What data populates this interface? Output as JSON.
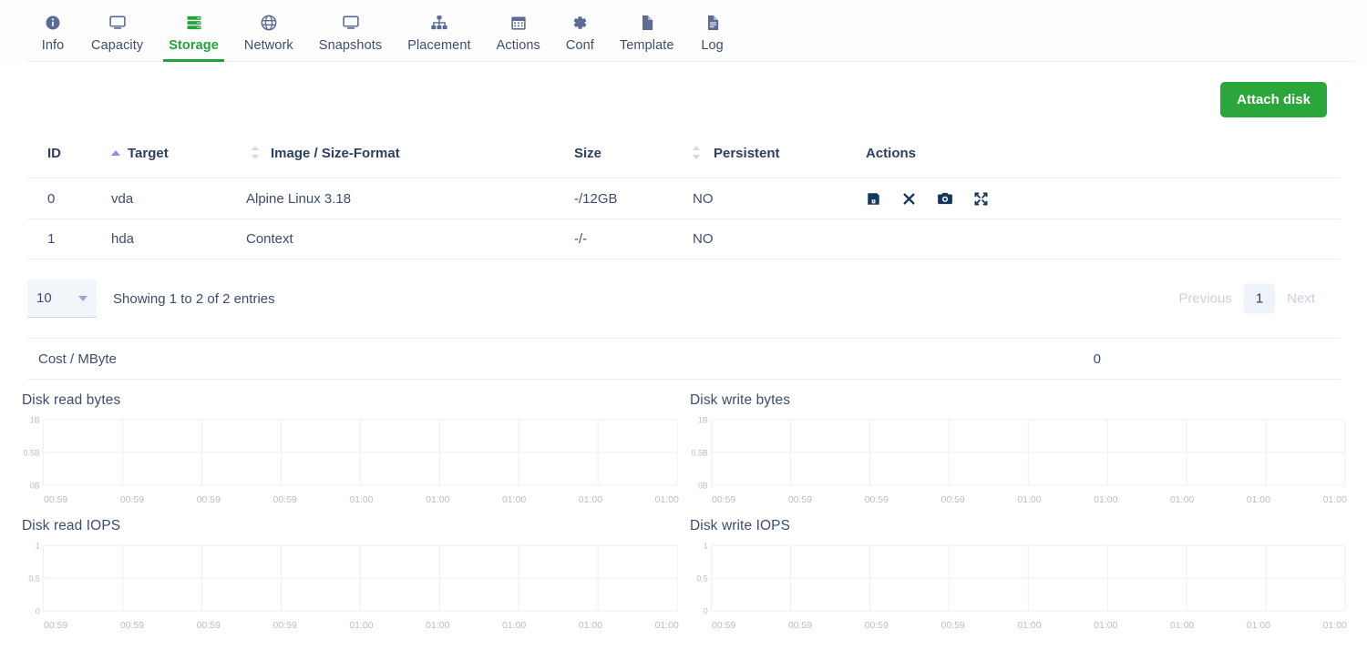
{
  "tabs": [
    {
      "label": "Info",
      "icon": "info-circle-icon",
      "active": false
    },
    {
      "label": "Capacity",
      "icon": "monitor-icon",
      "active": false
    },
    {
      "label": "Storage",
      "icon": "server-stack-icon",
      "active": true
    },
    {
      "label": "Network",
      "icon": "globe-icon",
      "active": false
    },
    {
      "label": "Snapshots",
      "icon": "monitor-icon",
      "active": false
    },
    {
      "label": "Placement",
      "icon": "sitemap-icon",
      "active": false
    },
    {
      "label": "Actions",
      "icon": "calendar-icon",
      "active": false
    },
    {
      "label": "Conf",
      "icon": "gear-icon",
      "active": false
    },
    {
      "label": "Template",
      "icon": "file-icon",
      "active": false
    },
    {
      "label": "Log",
      "icon": "file-lines-icon",
      "active": false
    }
  ],
  "toolbar": {
    "attach_disk_label": "Attach disk",
    "accent_green": "#2ba63b"
  },
  "table": {
    "headers": {
      "id": "ID",
      "target": "Target",
      "image": "Image / Size-Format",
      "size": "Size",
      "persistent": "Persistent",
      "actions": "Actions"
    },
    "sort": {
      "column": "Target",
      "direction": "asc",
      "active_color": "#8e8ee8"
    },
    "rows": [
      {
        "id": "0",
        "target": "vda",
        "image": "Alpine Linux 3.18",
        "size": "-/12GB",
        "persistent": "NO",
        "actions": [
          "save-icon",
          "detach-icon",
          "snapshot-icon",
          "resize-icon"
        ]
      },
      {
        "id": "1",
        "target": "hda",
        "image": "Context",
        "size": "-/-",
        "persistent": "NO",
        "actions": []
      }
    ]
  },
  "pagination": {
    "page_length": "10",
    "showing": "Showing 1 to 2 of 2 entries",
    "previous": "Previous",
    "next": "Next",
    "current_page": "1"
  },
  "cost": {
    "label": "Cost / MByte",
    "value": "0"
  },
  "chart_data": [
    {
      "type": "line",
      "title": "Disk read bytes",
      "xlabel": "",
      "ylabel": "",
      "x": [
        "00:59",
        "00:59",
        "00:59",
        "00:59",
        "01:00",
        "01:00",
        "01:00",
        "01:00",
        "01:00"
      ],
      "yticks": [
        "0B",
        "0.5B",
        "1B"
      ],
      "ylim": [
        0,
        1
      ],
      "series": [
        {
          "name": "Disk read bytes",
          "values": []
        }
      ],
      "grid": true,
      "legend": "none"
    },
    {
      "type": "line",
      "title": "Disk write bytes",
      "xlabel": "",
      "ylabel": "",
      "x": [
        "00:59",
        "00:59",
        "00:59",
        "00:59",
        "01:00",
        "01:00",
        "01:00",
        "01:00",
        "01:00"
      ],
      "yticks": [
        "0B",
        "0.5B",
        "1B"
      ],
      "ylim": [
        0,
        1
      ],
      "series": [
        {
          "name": "Disk write bytes",
          "values": []
        }
      ],
      "grid": true,
      "legend": "none"
    },
    {
      "type": "line",
      "title": "Disk read IOPS",
      "xlabel": "",
      "ylabel": "",
      "x": [
        "00:59",
        "00:59",
        "00:59",
        "00:59",
        "01:00",
        "01:00",
        "01:00",
        "01:00",
        "01:00"
      ],
      "yticks": [
        "0",
        "0.5",
        "1"
      ],
      "ylim": [
        0,
        1
      ],
      "series": [
        {
          "name": "Disk read IOPS",
          "values": []
        }
      ],
      "grid": true,
      "legend": "none"
    },
    {
      "type": "line",
      "title": "Disk write IOPS",
      "xlabel": "",
      "ylabel": "",
      "x": [
        "00:59",
        "00:59",
        "00:59",
        "00:59",
        "01:00",
        "01:00",
        "01:00",
        "01:00",
        "01:00"
      ],
      "yticks": [
        "0",
        "0.5",
        "1"
      ],
      "ylim": [
        0,
        1
      ],
      "series": [
        {
          "name": "Disk write IOPS",
          "values": []
        }
      ],
      "grid": true,
      "legend": "none"
    }
  ]
}
